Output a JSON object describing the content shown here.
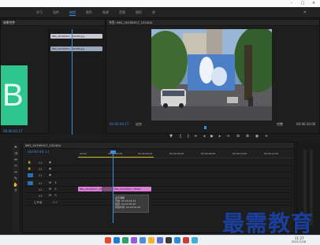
{
  "workspace_tabs": [
    "学习",
    "组件",
    "编辑",
    "颜色",
    "效果",
    "音频",
    "图形",
    "库"
  ],
  "active_tab_index": 2,
  "source_panel": {
    "title": "效果控件",
    "label": "节目 MG_20190917_1524",
    "tabs": [
      "效果控件"
    ]
  },
  "effect_clip_name": "IMG_20190917_1524...",
  "effect_clips": [
    "IMG_20190917_152404.jpg",
    "IMG_20190917_152404.jpg"
  ],
  "left_time": "00:00:04:17",
  "program": {
    "title": "节目: IMG_20190917_152404",
    "current_time": "00:00:04:17",
    "fit": "适合",
    "duration": "00:00:10:00",
    "quality": "完整"
  },
  "timeline": {
    "title": "IMG_20190917_152404",
    "current_time": "00:00:04:17",
    "ruler": [
      "00:00",
      "00:00:02:00",
      "00:00:04:00",
      "00:00:06:00",
      "00:00:08:00",
      "00:00:10:00",
      "00:00:12:00",
      "00:00:14:00"
    ],
    "tracks": [
      "V3",
      "V2",
      "V1",
      "A1",
      "A2",
      "A3"
    ],
    "master": "主声道",
    "master_value": "0.0",
    "clip_a": "IMG_20190917_1524",
    "clip_b": "IMG_20190917_15240",
    "tooltip_title": "IMG_20190917_152404.jpg",
    "tooltip_lines": [
      "交叉溶解",
      "开始: 00:00:03:24",
      "结束: 00:00:05:00",
      "持续时间: 00:00:01:00"
    ]
  },
  "taskbar": {
    "time": "11:27",
    "date": "2021/7/28"
  },
  "watermark": "最需教育",
  "big_letter": "B",
  "colors": {
    "accent": "#3e8ede",
    "clip_pink": "#dd7ed8",
    "clip_teal": "#2fc58f",
    "watermark": "#1a3f9e"
  }
}
